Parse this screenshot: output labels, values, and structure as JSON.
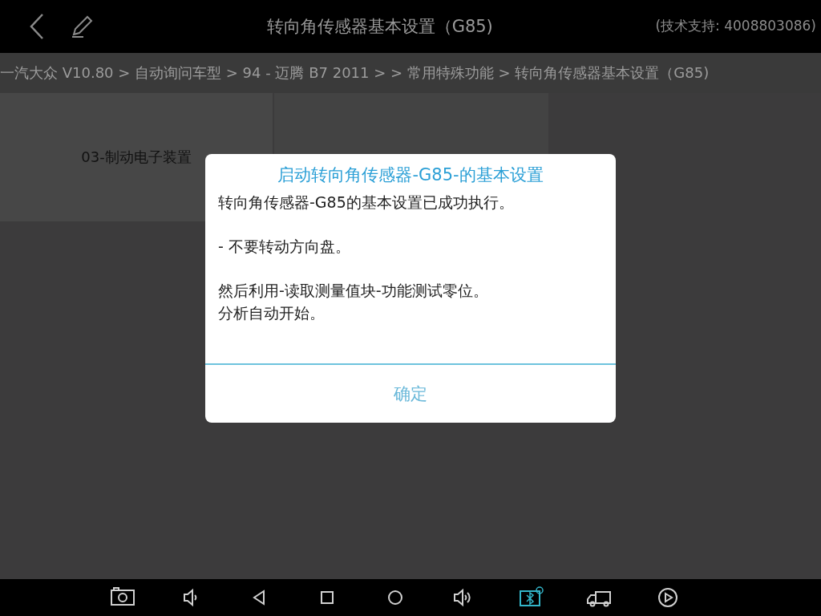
{
  "top_bar": {
    "title": "转向角传感器基本设置（G85)",
    "support": "(技术支持: 4008803086)"
  },
  "breadcrumb": "一汽大众 V10.80 > 自动询问车型 > 94 - 迈腾 B7 2011 > > 常用特殊功能 > 转向角传感器基本设置（G85)",
  "tiles": [
    {
      "label": "03-制动电子装置"
    }
  ],
  "dialog": {
    "title": "启动转向角传感器-G85-的基本设置",
    "paragraphs": [
      [
        "转向角传感器-G85的基本设置已成功执行。"
      ],
      [
        "- 不要转动方向盘。"
      ],
      [
        "然后利用-读取测量值块-功能测试零位。",
        "分析自动开始。"
      ]
    ],
    "button": "确定"
  },
  "nav_bar": [
    {
      "kind": "camera",
      "active": false
    },
    {
      "kind": "volume-down",
      "active": false
    },
    {
      "kind": "back",
      "active": false
    },
    {
      "kind": "recent",
      "active": false
    },
    {
      "kind": "home",
      "active": false
    },
    {
      "kind": "volume-up",
      "active": false
    },
    {
      "kind": "bluetooth",
      "active": true
    },
    {
      "kind": "truck",
      "active": false
    },
    {
      "kind": "play",
      "active": false
    }
  ]
}
